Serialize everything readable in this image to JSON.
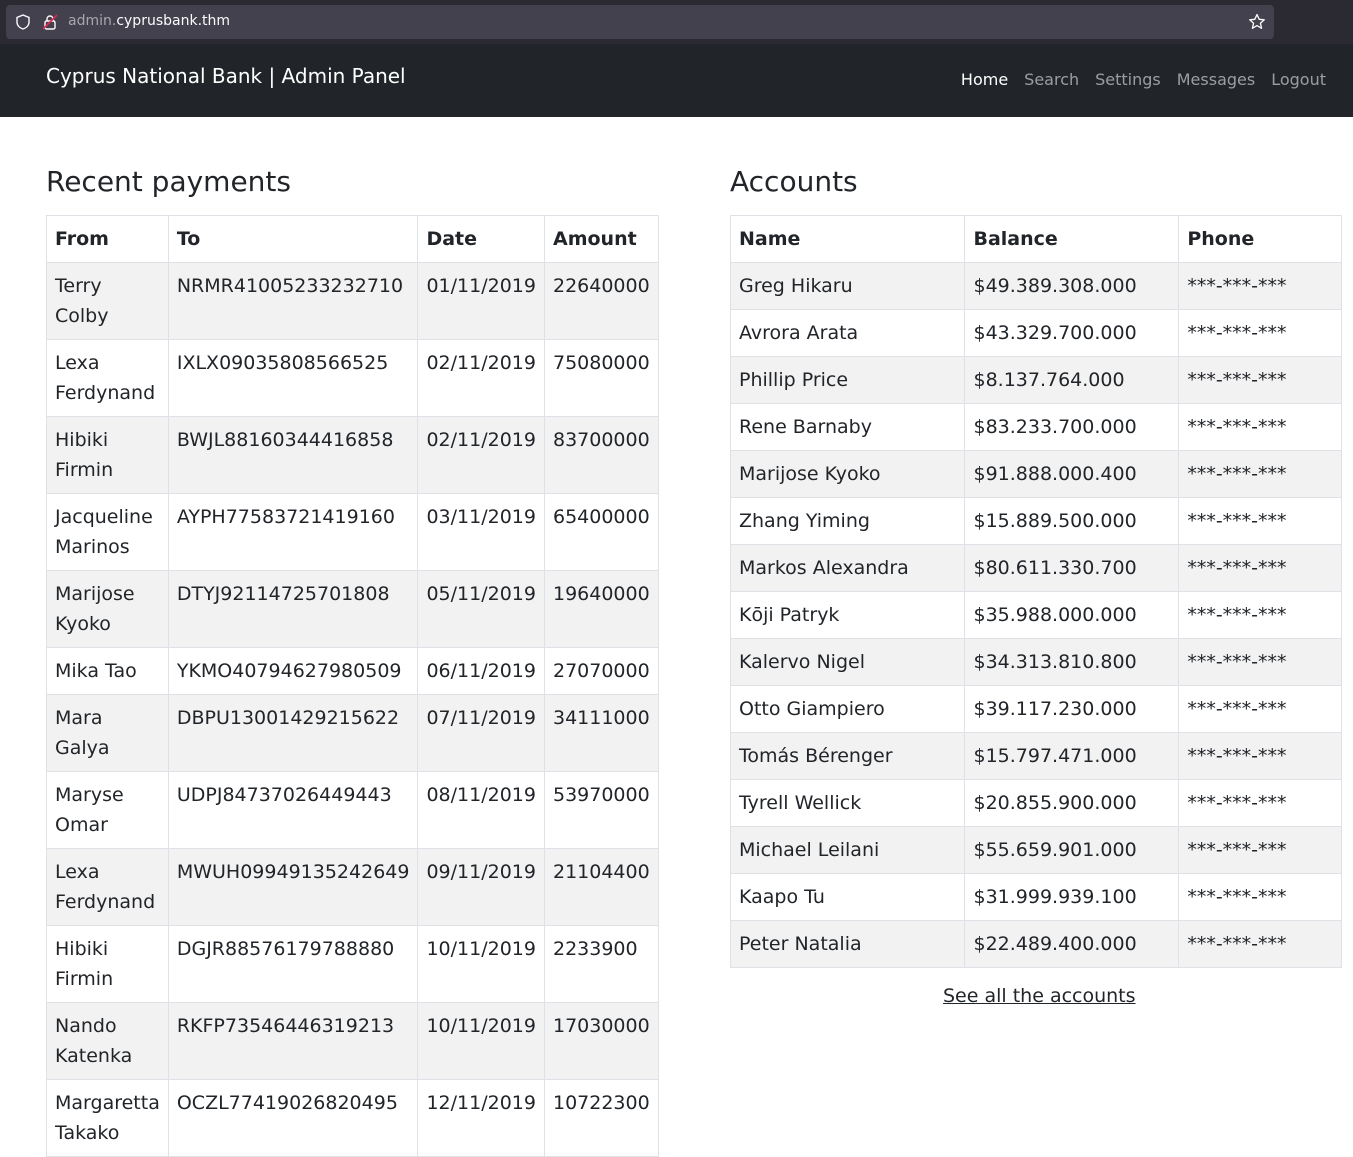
{
  "browser": {
    "url_host_prefix": "admin.",
    "url_host_main": "cyprusbank.thm"
  },
  "navbar": {
    "brand": "Cyprus National Bank | Admin Panel",
    "links": [
      "Home",
      "Search",
      "Settings",
      "Messages",
      "Logout"
    ]
  },
  "payments": {
    "title": "Recent payments",
    "columns": [
      "From",
      "To",
      "Date",
      "Amount"
    ],
    "rows": [
      [
        "Terry Colby",
        "NRMR41005233232710",
        "01/11/2019",
        "22640000"
      ],
      [
        "Lexa Ferdynand",
        "IXLX09035808566525",
        "02/11/2019",
        "75080000"
      ],
      [
        "Hibiki Firmin",
        "BWJL88160344416858",
        "02/11/2019",
        "83700000"
      ],
      [
        "Jacqueline Marinos",
        "AYPH77583721419160",
        "03/11/2019",
        "65400000"
      ],
      [
        "Marijose Kyoko",
        "DTYJ92114725701808",
        "05/11/2019",
        "19640000"
      ],
      [
        "Mika Tao",
        "YKMO40794627980509",
        "06/11/2019",
        "27070000"
      ],
      [
        "Mara Galya",
        "DBPU13001429215622",
        "07/11/2019",
        "34111000"
      ],
      [
        "Maryse Omar",
        "UDPJ84737026449443",
        "08/11/2019",
        "53970000"
      ],
      [
        "Lexa Ferdynand",
        "MWUH09949135242649",
        "09/11/2019",
        "21104400"
      ],
      [
        "Hibiki Firmin",
        "DGJR88576179788880",
        "10/11/2019",
        "2233900"
      ],
      [
        "Nando Katenka",
        "RKFP73546446319213",
        "10/11/2019",
        "17030000"
      ],
      [
        "Margaretta Takako",
        "OCZL77419026820495",
        "12/11/2019",
        "10722300"
      ]
    ]
  },
  "accounts": {
    "title": "Accounts",
    "columns": [
      "Name",
      "Balance",
      "Phone"
    ],
    "rows": [
      [
        "Greg Hikaru",
        "$49.389.308.000",
        "***-***-***"
      ],
      [
        "Avrora Arata",
        "$43.329.700.000",
        "***-***-***"
      ],
      [
        "Phillip Price",
        "$8.137.764.000",
        "***-***-***"
      ],
      [
        "Rene Barnaby",
        "$83.233.700.000",
        "***-***-***"
      ],
      [
        "Marijose Kyoko",
        "$91.888.000.400",
        "***-***-***"
      ],
      [
        "Zhang Yiming",
        "$15.889.500.000",
        "***-***-***"
      ],
      [
        "Markos Alexandra",
        "$80.611.330.700",
        "***-***-***"
      ],
      [
        "Kōji Patryk",
        "$35.988.000.000",
        "***-***-***"
      ],
      [
        "Kalervo Nigel",
        "$34.313.810.800",
        "***-***-***"
      ],
      [
        "Otto Giampiero",
        "$39.117.230.000",
        "***-***-***"
      ],
      [
        "Tomás Bérenger",
        "$15.797.471.000",
        "***-***-***"
      ],
      [
        "Tyrell Wellick",
        "$20.855.900.000",
        "***-***-***"
      ],
      [
        "Michael Leilani",
        "$55.659.901.000",
        "***-***-***"
      ],
      [
        "Kaapo Tu",
        "$31.999.939.100",
        "***-***-***"
      ],
      [
        "Peter Natalia",
        "$22.489.400.000",
        "***-***-***"
      ]
    ],
    "see_all": "See all the accounts"
  }
}
